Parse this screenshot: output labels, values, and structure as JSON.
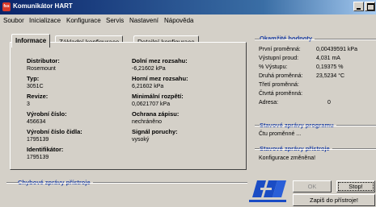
{
  "window": {
    "title": "Komunikátor HART",
    "icon_text": "fss"
  },
  "menu": [
    "Soubor",
    "Inicializace",
    "Konfigurace",
    "Servis",
    "Nastavení",
    "Nápověda"
  ],
  "tabs": [
    "Informace",
    "Základní konfigurace",
    "Detailní konfigurace"
  ],
  "info": {
    "distributor_label": "Distributor:",
    "distributor": "Rosemount",
    "typ_label": "Typ:",
    "typ": "3051C",
    "revize_label": "Revize:",
    "revize": "3",
    "vyrobni_label": "Výrobní číslo:",
    "vyrobni": "456634",
    "vyrobni_cidla_label": "Výrobní číslo čidla:",
    "vyrobni_cidla": "1795139",
    "identifikator_label": "Identifikátor:",
    "identifikator": "1795139",
    "dolni_label": "Dolní mez rozsahu:",
    "dolni": "-6,21602 kPa",
    "horni_label": "Horní mez rozsahu:",
    "horni": "6,21602 kPa",
    "minimalni_label": "Minimální rozpětí:",
    "minimalni": "0,0621707 kPa",
    "ochrana_label": "Ochrana zápisu:",
    "ochrana": "nechráněno",
    "signal_label": "Signál poruchy:",
    "signal": "vysoký"
  },
  "device_errors": {
    "title": "Chybové zprávy přístroje"
  },
  "current_values": {
    "title": "Okamžité hodnoty",
    "rows": [
      {
        "label": "První proměnná:",
        "value": "0,00439591 kPa"
      },
      {
        "label": "Výstupní proud:",
        "value": "4,031 mA"
      },
      {
        "label": "% Výstupu:",
        "value": "0,19375 %"
      },
      {
        "label": "Druhá proměnná:",
        "value": "23,5234 °C"
      },
      {
        "label": "Třetí proměnná:",
        "value": ""
      },
      {
        "label": "Čtvrtá proměnná:",
        "value": ""
      },
      {
        "label": "Adresa:",
        "value": "0"
      }
    ]
  },
  "program_status": {
    "title": "Stavové zprávy programu",
    "message": "Čtu proměnné ..."
  },
  "device_status": {
    "title": "Stavové zprávy přístroje",
    "message": "Konfigurace změněna!"
  },
  "buttons": {
    "ok": "OK",
    "stop": "Stop!",
    "write": "Zapiš do přístroje!"
  }
}
